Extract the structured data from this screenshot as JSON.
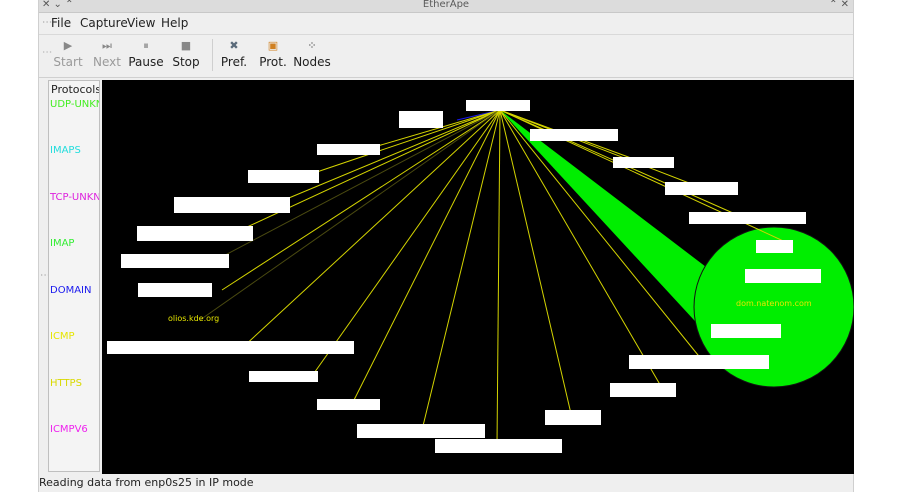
{
  "window": {
    "title": "EtherApe",
    "controls_left": "✕ ⌄ ⌃",
    "controls_right": "⌃ ✕"
  },
  "menu": {
    "file": "File",
    "capture": "Capture",
    "view": "View",
    "help": "Help"
  },
  "toolbar": {
    "start": "Start",
    "next": "Next",
    "pause": "Pause",
    "stop": "Stop",
    "pref": "Pref.",
    "prot": "Prot.",
    "nodes": "Nodes",
    "icons": {
      "start": "play-icon",
      "next": "skip-next-icon",
      "pause": "pause-icon",
      "stop": "stop-icon",
      "pref": "preferences-icon",
      "prot": "protocols-icon",
      "nodes": "nodes-icon"
    }
  },
  "protocols": {
    "header": "Protocols",
    "items": [
      {
        "label": "UDP-UNKN",
        "color": "#44ee22"
      },
      {
        "label": "IMAPS",
        "color": "#22dddd"
      },
      {
        "label": "TCP-UNKN",
        "color": "#dd22dd"
      },
      {
        "label": "IMAP",
        "color": "#33ee33"
      },
      {
        "label": "DOMAIN",
        "color": "#1a1aee"
      },
      {
        "label": "ICMP",
        "color": "#e6e600"
      },
      {
        "label": "HTTPS",
        "color": "#d9d900"
      },
      {
        "label": "ICMPV6",
        "color": "#ee22ee"
      }
    ]
  },
  "graph": {
    "node_labels": {
      "left": "olios.kde.org",
      "right": "dom.natenom.com"
    },
    "colors": {
      "canvas": "#000000",
      "link_yellow": "#d4d400",
      "link_dim": "#4a4a10",
      "link_blue": "#1a1aee",
      "highlight": "#00ee00",
      "label_box": "#ffffff",
      "label_text": "#e6e600"
    }
  },
  "status": {
    "text": "Reading data from enp0s25 in IP mode"
  }
}
